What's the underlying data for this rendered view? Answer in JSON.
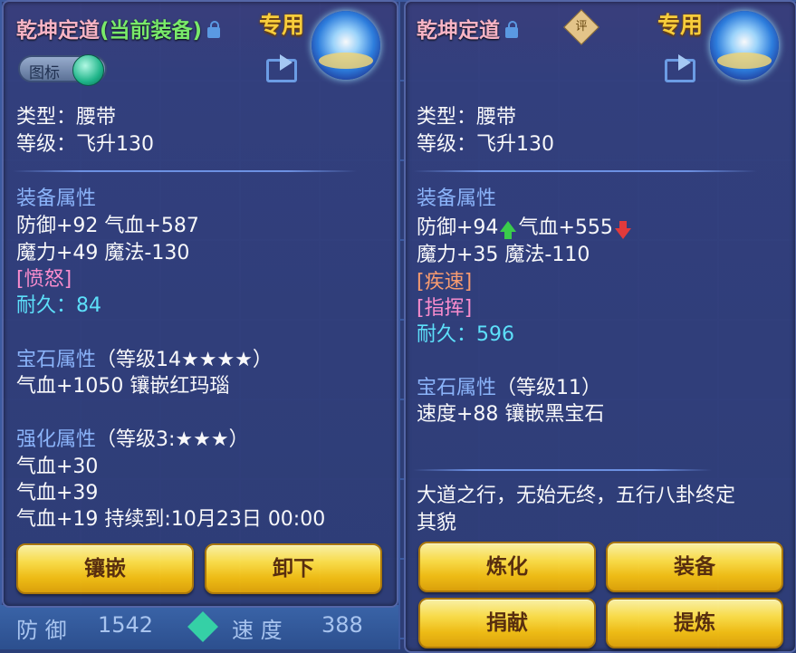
{
  "left": {
    "title_main": "乾坤定道",
    "title_suffix": "(当前装备)",
    "zhuanyong": "专用",
    "toggle_label": "图标",
    "type_line": "类型：腰带",
    "level_line": "等级：飞升130",
    "attr_header": "装备属性",
    "attr_line1": "防御+92 气血+587",
    "attr_line2": "魔力+49 魔法-130",
    "special": "[愤怒]",
    "durability_label": "耐久：",
    "durability_value": "84",
    "gem_header": "宝石属性",
    "gem_level": "（等级14★★★★）",
    "gem_line": "气血+1050 镶嵌红玛瑙",
    "enhance_header": "强化属性",
    "enhance_level": "（等级3:★★★）",
    "enhance_line1": "气血+30",
    "enhance_line2": "气血+39",
    "enhance_line3": "气血+19    持续到:10月23日 00:00",
    "btn_inlay": "镶嵌",
    "btn_unequip": "卸下"
  },
  "right": {
    "title_main": "乾坤定道",
    "ping_badge": "评",
    "zhuanyong": "专用",
    "type_line": "类型：腰带",
    "level_line": "等级：飞升130",
    "attr_header": "装备属性",
    "attr_def": "防御+94",
    "attr_hp": "气血+555",
    "attr_line2": "魔力+35 魔法-110",
    "special1": "[疾速]",
    "special2": "[指挥]",
    "durability_label": "耐久：",
    "durability_value": "596",
    "gem_header": "宝石属性",
    "gem_level": "（等级11）",
    "gem_line": "速度+88 镶嵌黑宝石",
    "description_line1": "大道之行，无始无终，五行八卦终定",
    "description_line2": "其貌",
    "btn_refine": "炼化",
    "btn_equip": "装备",
    "btn_donate": "捐献",
    "btn_extract": "提炼"
  },
  "background": {
    "defense_label": "防 御",
    "defense_value": "1542",
    "speed_label": "速 度",
    "speed_value": "388"
  },
  "colors": {
    "title": "#ffb8c8",
    "current_tag": "#7cf06a",
    "section": "#8fb8ff",
    "durability": "#5fe6ff",
    "button": "#f4bf12"
  }
}
